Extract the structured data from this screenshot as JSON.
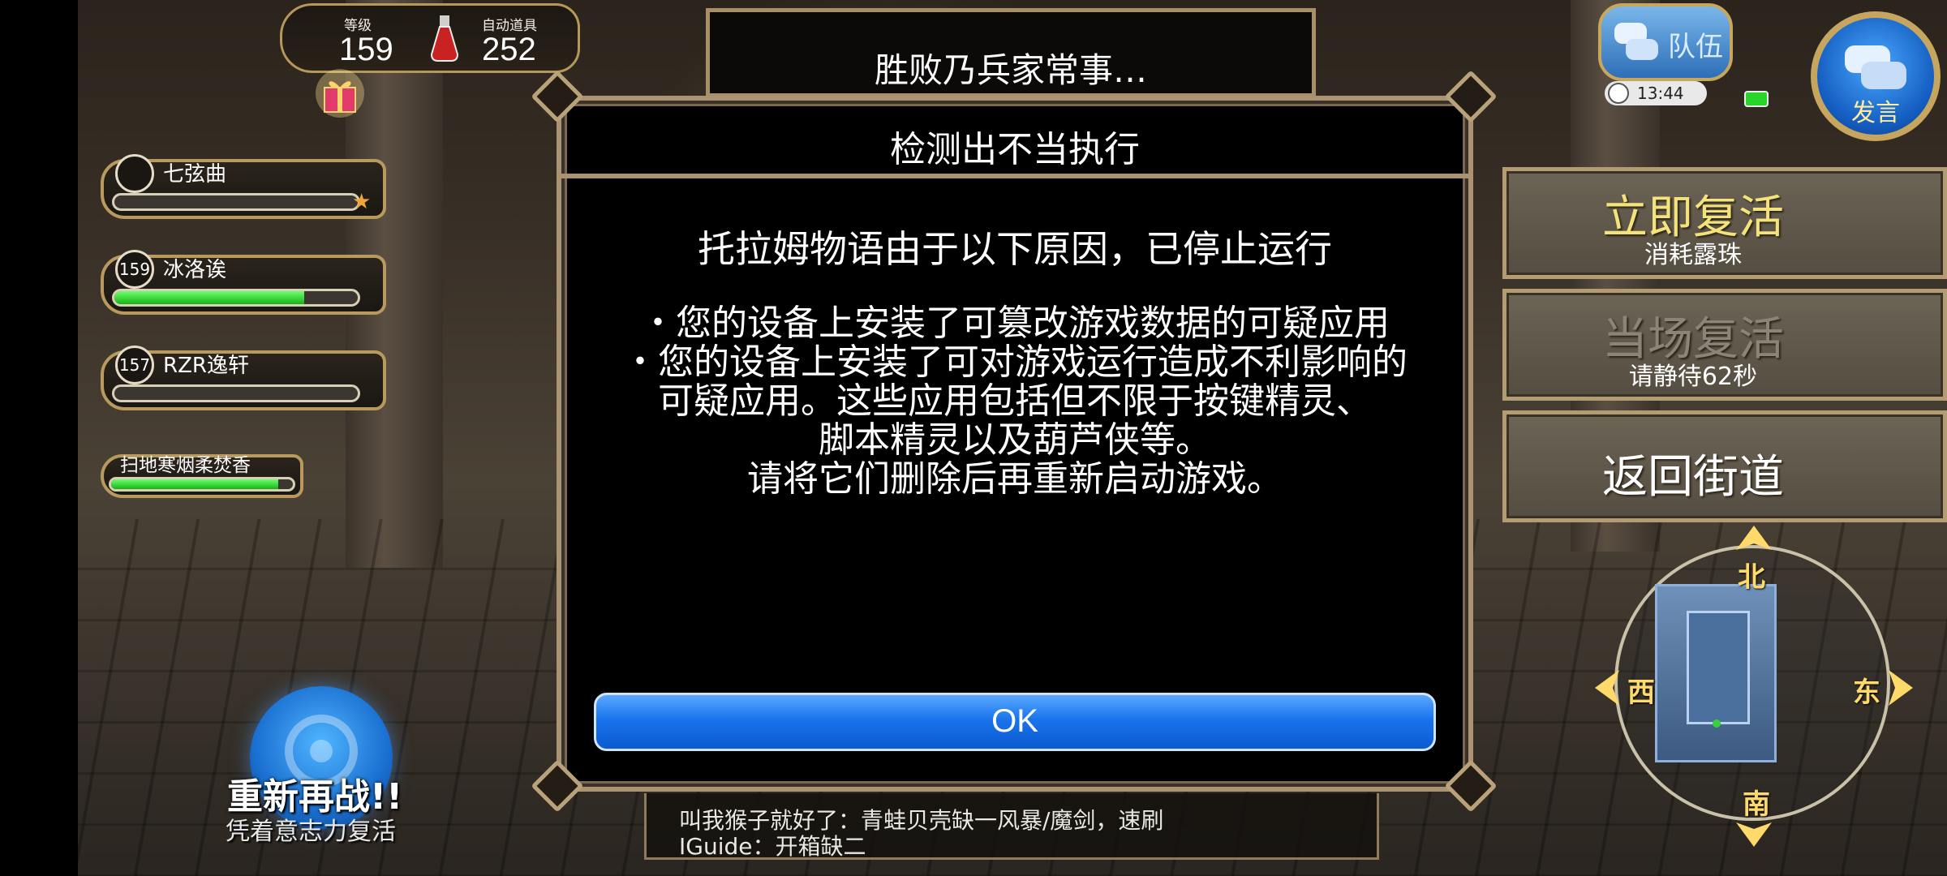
{
  "stats": {
    "level_label": "等级",
    "level_value": "159",
    "auto_item_label": "自动道具",
    "auto_item_value": "252"
  },
  "party": [
    {
      "name": "七弦曲",
      "level": "",
      "hp": 0
    },
    {
      "name": "冰洛诶",
      "level": "159",
      "hp": 0.78
    },
    {
      "name": "RZR逸轩",
      "level": "157",
      "hp": 0
    },
    {
      "name": "扫地寒烟柔焚香",
      "level": "",
      "hp": 0.92
    }
  ],
  "retry": {
    "title": "重新再战!!",
    "subtitle": "凭着意志力复活"
  },
  "defeat_box": {
    "text": "胜败乃兵家常事…"
  },
  "modal": {
    "title": "检测出不当执行",
    "heading": "托拉姆物语由于以下原因，已停止运行",
    "lines": [
      "・您的设备上安装了可篡改游戏数据的可疑应用",
      "・您的设备上安装了可对游戏运行造成不利影响的",
      "可疑应用。这些应用包括但不限于按键精灵、",
      "脚本精灵以及葫芦侠等。",
      "请将它们删除后再重新启动游戏。"
    ],
    "ok_label": "OK"
  },
  "chat": {
    "lines": [
      "叫我猴子就好了：青蛙贝壳缺一风暴/魔剑，速刷",
      "IGuide：开箱缺二"
    ]
  },
  "top_right": {
    "team_label": "队伍",
    "clock": "13:44",
    "speak_label": "发言"
  },
  "revive_menu": {
    "instant_title": "立即复活",
    "instant_sub": "消耗露珠",
    "later_title": "当场复活",
    "later_sub": "请静待62秒",
    "back_title": "返回街道"
  },
  "compass": {
    "north": "北",
    "east": "东",
    "south": "南",
    "west": "西"
  },
  "colors": {
    "ok_button": "#1a74ec",
    "frame_gold": "#b99a5e",
    "hp_green": "#17b317",
    "revive_title": "#f3e37a"
  }
}
